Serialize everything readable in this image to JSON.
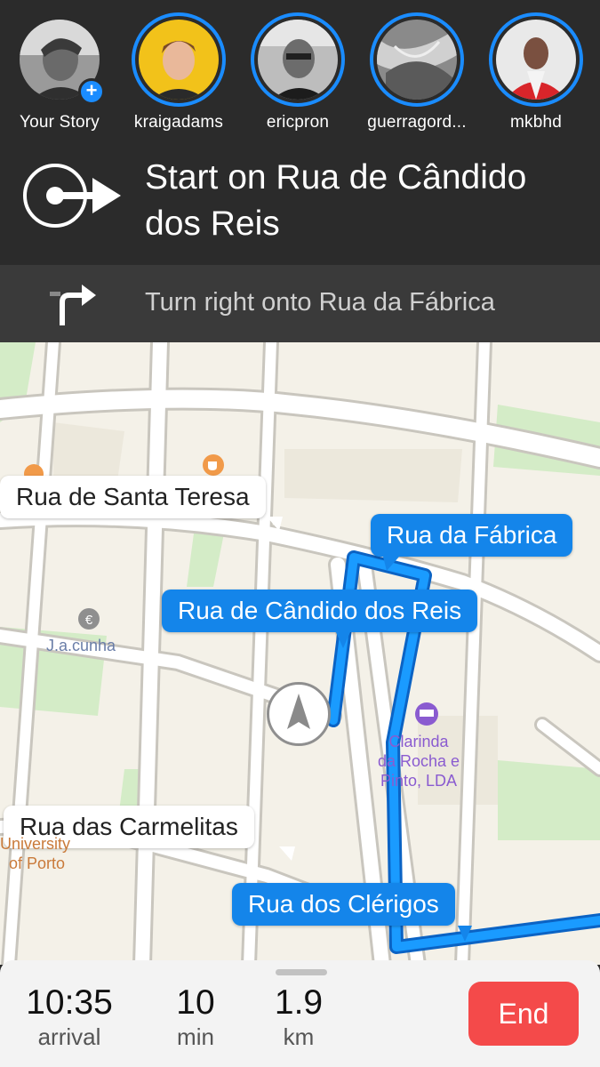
{
  "stories": [
    {
      "name": "Your Story",
      "has_add": true,
      "add_symbol": "+"
    },
    {
      "name": "kraigadams"
    },
    {
      "name": "ericpron"
    },
    {
      "name": "guerragord..."
    },
    {
      "name": "mkbhd"
    }
  ],
  "navigation": {
    "primary_instruction": "Start on Rua de Cândido dos Reis",
    "secondary_instruction": "Turn right onto Rua da Fábrica",
    "primary_icon": "start-arrow-icon",
    "secondary_icon": "turn-right-icon"
  },
  "map": {
    "street_labels": {
      "santa_teresa": "Rua de Santa Teresa",
      "fabrica": "Rua da Fábrica",
      "candido_reis": "Rua de Cândido dos Reis",
      "carmelitas": "Rua das Carmelitas",
      "clerigos": "Rua dos Clérigos"
    },
    "pois": {
      "jacunha": "J.a.cunha",
      "clarinda": "Clarinda\nda Rocha e\nPinto, LDA",
      "university_line1": "University",
      "university_line2": "of Porto"
    },
    "colors": {
      "route": "#1485ea",
      "route_label": "#1485ea",
      "poi_purple": "#8a5bd0",
      "poi_orange": "#c97a3a"
    }
  },
  "trip": {
    "arrival_time": "10:35",
    "arrival_label": "arrival",
    "duration_value": "10",
    "duration_unit": "min",
    "distance_value": "1.9",
    "distance_unit": "km",
    "end_label": "End",
    "end_color": "#f44a4a"
  }
}
